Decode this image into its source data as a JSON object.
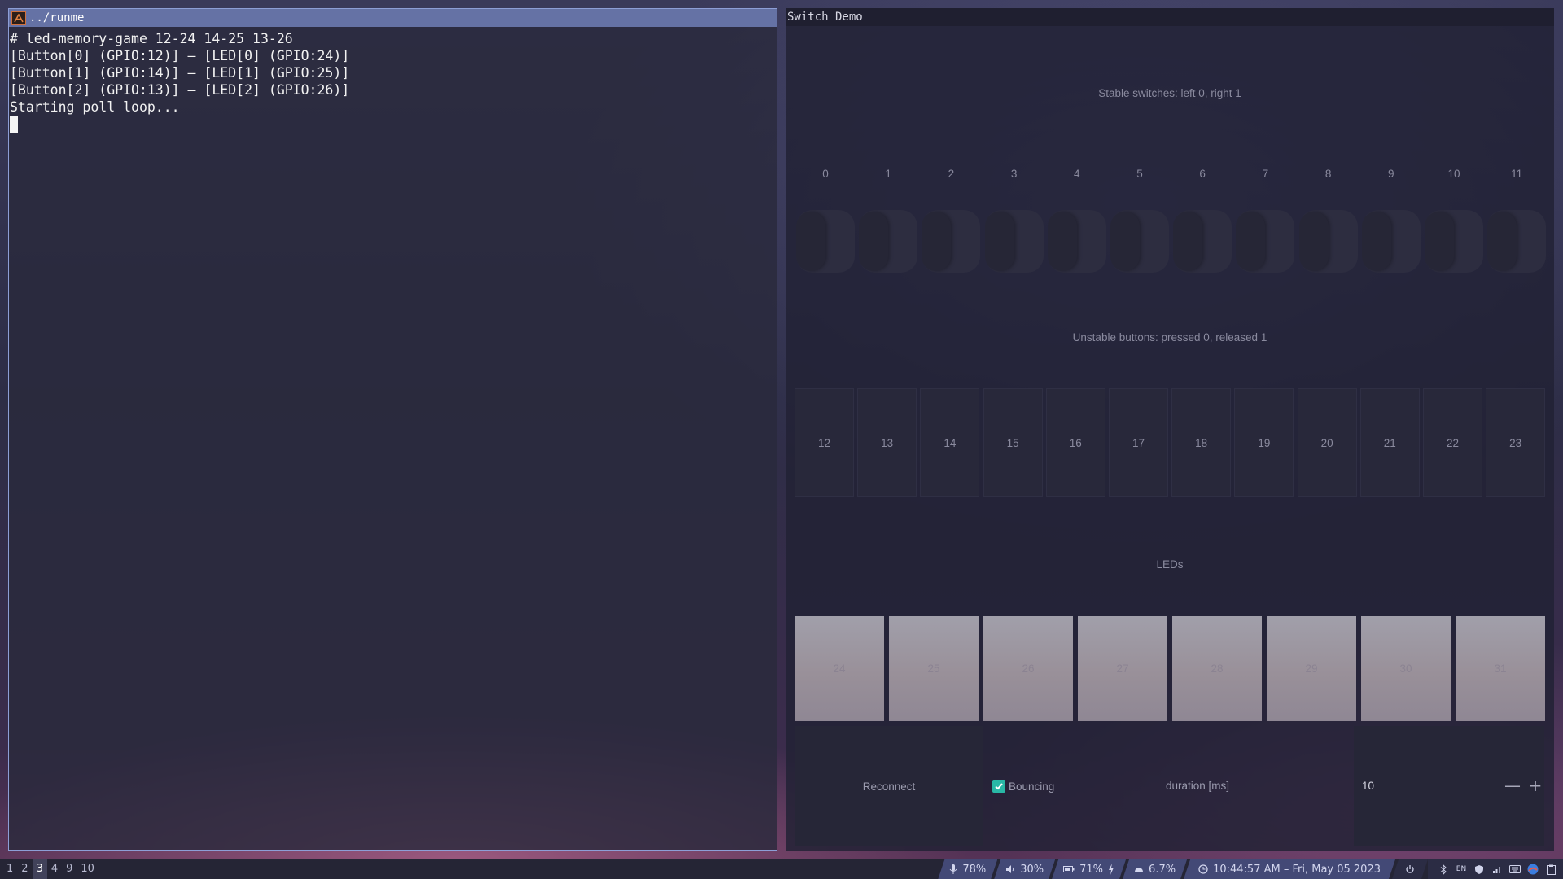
{
  "terminal": {
    "title": "../runme",
    "lines": [
      "# led-memory-game 12-24 14-25 13-26",
      "[Button[0] (GPIO:12)] – [LED[0] (GPIO:24)]",
      "[Button[1] (GPIO:14)] – [LED[1] (GPIO:25)]",
      "[Button[2] (GPIO:13)] – [LED[2] (GPIO:26)]",
      "Starting poll loop..."
    ]
  },
  "demo": {
    "title": "Switch Demo",
    "stable_heading": "Stable switches: left 0, right 1",
    "switches": [
      "0",
      "1",
      "2",
      "3",
      "4",
      "5",
      "6",
      "7",
      "8",
      "9",
      "10",
      "11"
    ],
    "unstable_heading": "Unstable buttons: pressed 0, released 1",
    "buttons": [
      "12",
      "13",
      "14",
      "15",
      "16",
      "17",
      "18",
      "19",
      "20",
      "21",
      "22",
      "23"
    ],
    "leds_heading": "LEDs",
    "leds": [
      "24",
      "25",
      "26",
      "27",
      "28",
      "29",
      "30",
      "31"
    ],
    "reconnect_label": "Reconnect",
    "bouncing_label": "Bouncing",
    "bouncing_checked": true,
    "duration_label": "duration [ms]",
    "duration_value": "10",
    "minus_label": "—",
    "plus_label": "+"
  },
  "bar": {
    "workspaces": [
      "1",
      "2",
      "3",
      "4",
      "9",
      "10"
    ],
    "active_workspace": "3",
    "mic": "78%",
    "volume": "30%",
    "battery": "71%",
    "cpu": "6.7%",
    "clock": "10:44:57 AM – Fri, May 05 2023",
    "lang": "EN",
    "colors": {
      "accent": "#434976",
      "checkbox": "#29b8a6"
    },
    "icons": [
      "microphone-icon",
      "speaker-icon",
      "battery-icon",
      "charging-icon",
      "cpu-icon",
      "clock-icon",
      "power-icon",
      "bluetooth-icon",
      "shield-icon",
      "network-icon",
      "keyboard-icon",
      "browser-icon",
      "clipboard-icon"
    ]
  }
}
